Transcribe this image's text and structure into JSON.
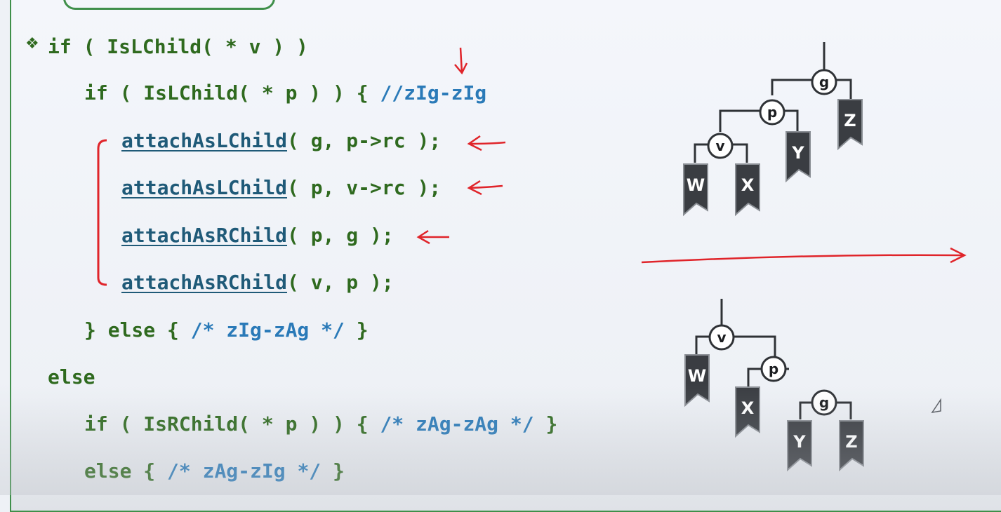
{
  "code": {
    "bullet": "❖",
    "line1": "if ( IsLChild( * v ) )",
    "line2_code": "if ( IsLChild( * p ) ) { ",
    "line2_comment": "//zIg-zIg",
    "line3_fn": "attachAsLChild",
    "line3_args": "( g, p->rc );",
    "line4_fn": "attachAsLChild",
    "line4_args": "( p, v->rc );",
    "line5_fn": "attachAsRChild",
    "line5_args": "( p, g );",
    "line6_fn": "attachAsRChild",
    "line6_args": "( v, p );",
    "line7_open": "} else { ",
    "line7_comment": "/* zIg-zAg */",
    "line7_close": " }",
    "line8": "else",
    "line9_code": "if ( IsRChild( * p ) ) { ",
    "line9_comment": "/* zAg-zAg */",
    "line9_close": " }",
    "line10_open": "else { ",
    "line10_comment": "/* zAg-zIg */",
    "line10_close": " }"
  },
  "tree_before": {
    "nodes": [
      "g",
      "p",
      "v"
    ],
    "subtrees": [
      "W",
      "X",
      "Y",
      "Z"
    ]
  },
  "tree_after": {
    "nodes": [
      "v",
      "p",
      "g"
    ],
    "subtrees": [
      "W",
      "X",
      "Y",
      "Z"
    ]
  },
  "colors": {
    "code_green": "#2f6a1f",
    "comment_blue": "#2a7ab8",
    "annotation_red": "#e0242a",
    "frame_green": "#3f8f4a",
    "subtree_fill": "#3a3d42"
  }
}
